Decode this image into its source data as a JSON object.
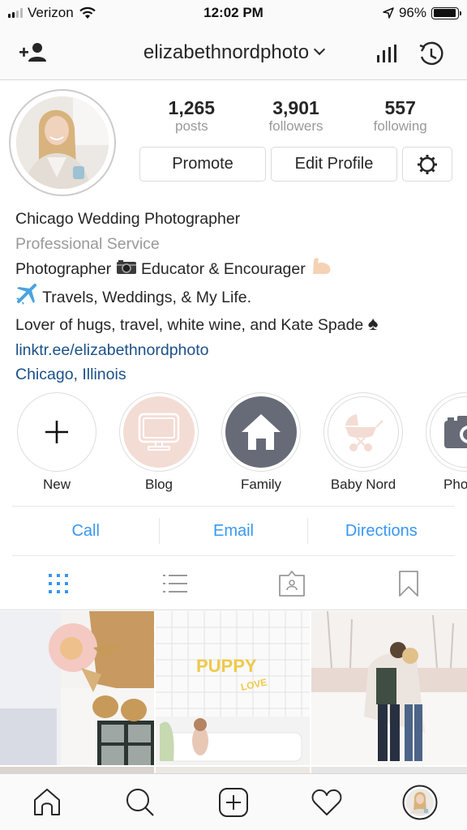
{
  "status_bar": {
    "carrier": "Verizon",
    "time": "12:02 PM",
    "battery_percent_label": "96%",
    "battery_level": 0.96,
    "signal_bars_active": 2,
    "signal_bars_total": 4
  },
  "nav": {
    "username": "elizabethnordphoto",
    "left_icon": "add-person-icon",
    "right_icons": [
      "insights-icon",
      "archive-history-icon"
    ]
  },
  "profile": {
    "stats": [
      {
        "value": "1,265",
        "label": "posts"
      },
      {
        "value": "3,901",
        "label": "followers"
      },
      {
        "value": "557",
        "label": "following"
      }
    ],
    "buttons": {
      "promote": "Promote",
      "edit_profile": "Edit Profile",
      "settings_icon": "gear-icon"
    }
  },
  "bio": {
    "name": "Chicago Wedding Photographer",
    "category": "Professional Service",
    "line1_a": "Photographer",
    "line1_emoji1": "📷",
    "line1_b": "Educator & Encourager",
    "line1_emoji2": "💪",
    "line2_emoji": "✈️",
    "line2": "Travels, Weddings, & My Life.",
    "line3": "Lover of hugs, travel, white wine, and Kate Spade",
    "line3_emoji": "♠",
    "link": "linktr.ee/elizabethnordphoto",
    "location": "Chicago, Illinois"
  },
  "highlights": [
    {
      "label": "New",
      "icon": "plus-icon"
    },
    {
      "label": "Blog",
      "icon": "monitor-icon",
      "color": "#f3dcd4"
    },
    {
      "label": "Family",
      "icon": "house-icon",
      "color": "#676b78"
    },
    {
      "label": "Baby Nord",
      "icon": "stroller-icon",
      "color": "#f3dcd4"
    },
    {
      "label": "Photog",
      "icon": "camera-icon",
      "color": "#676b78"
    }
  ],
  "contacts": [
    {
      "label": "Call"
    },
    {
      "label": "Email"
    },
    {
      "label": "Directions"
    }
  ],
  "tabs": [
    {
      "name": "grid",
      "icon": "grid-icon",
      "active": true
    },
    {
      "name": "list",
      "icon": "list-icon",
      "active": false
    },
    {
      "name": "tagged",
      "icon": "tagged-icon",
      "active": false
    },
    {
      "name": "saved",
      "icon": "bookmark-icon",
      "active": false
    }
  ],
  "grid_posts": [
    {
      "description": "wedding cake with pink flower and gold masks"
    },
    {
      "description": "PUPPY LOVE balloons with dog on white sofa",
      "text": "PUPPY",
      "text2": "LOVE"
    },
    {
      "description": "couple embracing in snow"
    }
  ],
  "bottom_bar": [
    {
      "name": "home",
      "icon": "home-icon"
    },
    {
      "name": "search",
      "icon": "search-icon"
    },
    {
      "name": "new-post",
      "icon": "add-post-icon"
    },
    {
      "name": "activity",
      "icon": "heart-icon"
    },
    {
      "name": "profile",
      "icon": "profile-avatar-icon"
    }
  ],
  "colors": {
    "link_blue": "#1c5089",
    "action_blue": "#3897f0",
    "muted_gray": "#999999",
    "highlight_pink": "#f3dcd4",
    "highlight_slate": "#676b78"
  }
}
